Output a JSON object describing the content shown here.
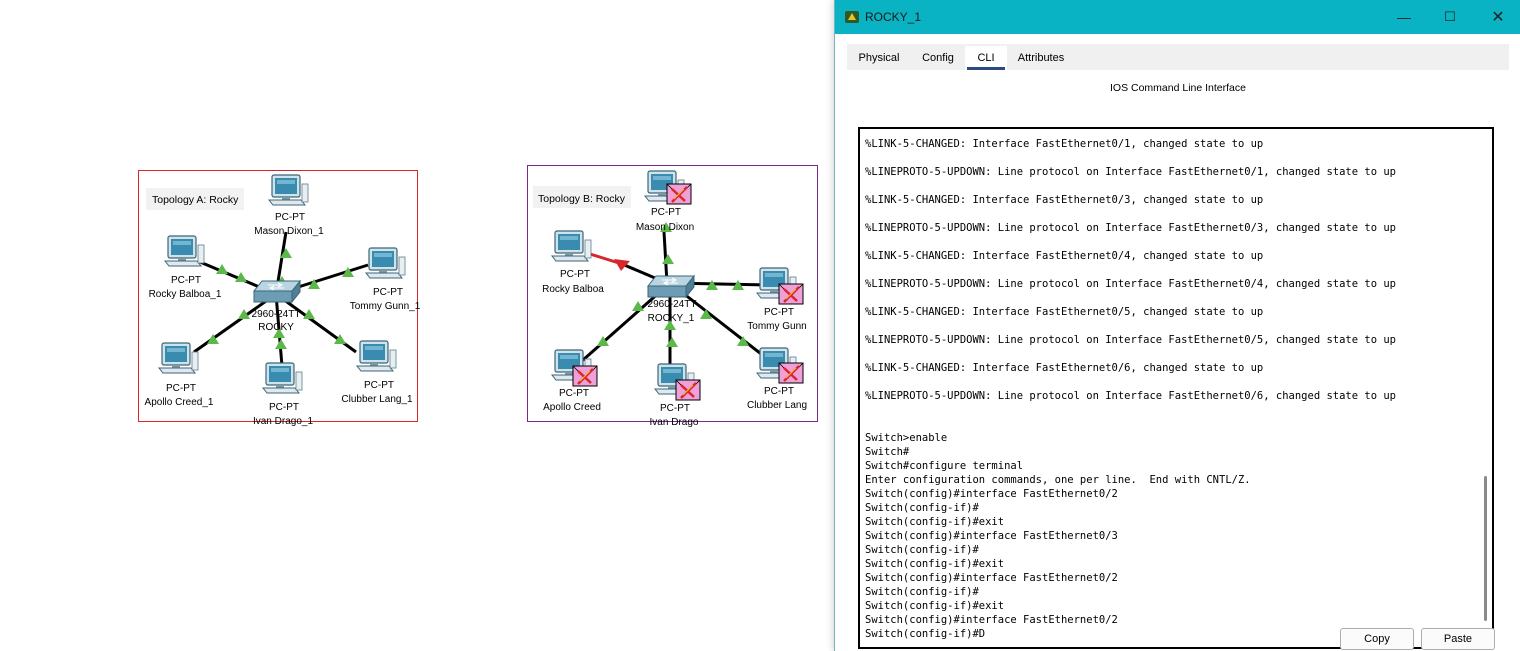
{
  "workspace": {
    "topologyA": {
      "title": "Topology A: Rocky",
      "switch": {
        "model": "2960-24TT",
        "name": "ROCKY"
      },
      "pcs": [
        {
          "type": "PC-PT",
          "name": "Mason Dixon_1"
        },
        {
          "type": "PC-PT",
          "name": "Rocky Balboa_1"
        },
        {
          "type": "PC-PT",
          "name": "Tommy Gunn_1"
        },
        {
          "type": "PC-PT",
          "name": "Apollo Creed_1"
        },
        {
          "type": "PC-PT",
          "name": "Ivan Drago_1"
        },
        {
          "type": "PC-PT",
          "name": "Clubber Lang_1"
        }
      ]
    },
    "topologyB": {
      "title": "Topology B: Rocky",
      "switch": {
        "model": "2960-24TT",
        "name": "ROCKY_1"
      },
      "pcs": [
        {
          "type": "PC-PT",
          "name": "Mason Dixon"
        },
        {
          "type": "PC-PT",
          "name": "Rocky Balboa"
        },
        {
          "type": "PC-PT",
          "name": "Tommy Gunn"
        },
        {
          "type": "PC-PT",
          "name": "Apollo Creed"
        },
        {
          "type": "PC-PT",
          "name": "Ivan Drago"
        },
        {
          "type": "PC-PT",
          "name": "Clubber Lang"
        }
      ]
    }
  },
  "window": {
    "title": "ROCKY_1",
    "icon": "packet-tracer-icon",
    "controls": {
      "minimize": "—",
      "maximize": "☐",
      "close": "✕"
    },
    "tabs": [
      "Physical",
      "Config",
      "CLI",
      "Attributes"
    ],
    "active_tab": "CLI",
    "cli_heading": "IOS Command Line Interface",
    "cli_lines": [
      "%LINK-5-CHANGED: Interface FastEthernet0/1, changed state to up",
      "",
      "%LINEPROTO-5-UPDOWN: Line protocol on Interface FastEthernet0/1, changed state to up",
      "",
      "%LINK-5-CHANGED: Interface FastEthernet0/3, changed state to up",
      "",
      "%LINEPROTO-5-UPDOWN: Line protocol on Interface FastEthernet0/3, changed state to up",
      "",
      "%LINK-5-CHANGED: Interface FastEthernet0/4, changed state to up",
      "",
      "%LINEPROTO-5-UPDOWN: Line protocol on Interface FastEthernet0/4, changed state to up",
      "",
      "%LINK-5-CHANGED: Interface FastEthernet0/5, changed state to up",
      "",
      "%LINEPROTO-5-UPDOWN: Line protocol on Interface FastEthernet0/5, changed state to up",
      "",
      "%LINK-5-CHANGED: Interface FastEthernet0/6, changed state to up",
      "",
      "%LINEPROTO-5-UPDOWN: Line protocol on Interface FastEthernet0/6, changed state to up",
      "",
      "",
      "Switch>enable",
      "Switch#",
      "Switch#configure terminal",
      "Enter configuration commands, one per line.  End with CNTL/Z.",
      "Switch(config)#interface FastEthernet0/2",
      "Switch(config-if)#",
      "Switch(config-if)#exit",
      "Switch(config)#interface FastEthernet0/3",
      "Switch(config-if)#",
      "Switch(config-if)#exit",
      "Switch(config)#interface FastEthernet0/2",
      "Switch(config-if)#",
      "Switch(config-if)#exit",
      "Switch(config)#interface FastEthernet0/2",
      "Switch(config-if)#D"
    ],
    "buttons": {
      "copy": "Copy",
      "paste": "Paste"
    }
  },
  "colors": {
    "titlebar": "#0ab3c3",
    "topologyA_border": "#d9262c",
    "topologyB_border": "#7b2a8c",
    "link_up": "#5cb848",
    "link_down": "#d9262c",
    "pdu_envelope": "#f0a0d8"
  }
}
